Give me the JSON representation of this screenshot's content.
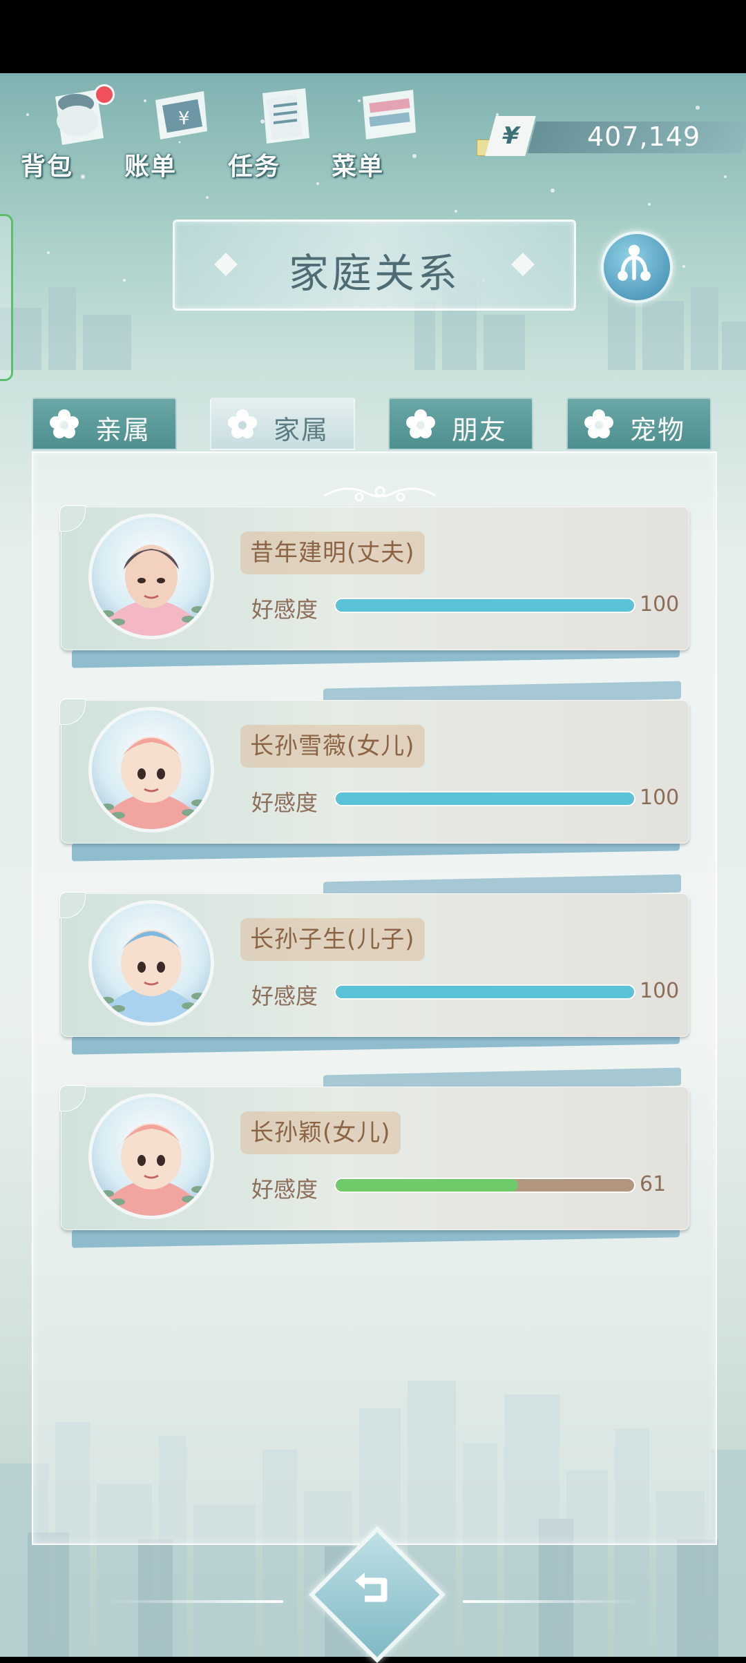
{
  "toolbar": {
    "bag_label": "背包",
    "bills_label": "账单",
    "tasks_label": "任务",
    "menu_label": "菜单"
  },
  "currency": {
    "symbol": "¥",
    "amount": "407,149"
  },
  "page": {
    "title": "家庭关系"
  },
  "tabs": [
    {
      "label": "亲属",
      "active": false
    },
    {
      "label": "家属",
      "active": true
    },
    {
      "label": "朋友",
      "active": false
    },
    {
      "label": "宠物",
      "active": false
    }
  ],
  "affinity_label": "好感度",
  "members": [
    {
      "name": "昔年建明(丈夫)",
      "affinity": 100,
      "max": 100,
      "bar_color": "#5bc3d8",
      "avatar_icon": "husband-avatar"
    },
    {
      "name": "长孙雪薇(女儿)",
      "affinity": 100,
      "max": 100,
      "bar_color": "#5bc3d8",
      "avatar_icon": "daughter-avatar"
    },
    {
      "name": "长孙子生(儿子)",
      "affinity": 100,
      "max": 100,
      "bar_color": "#5bc3d8",
      "avatar_icon": "son-avatar"
    },
    {
      "name": "长孙颖(女儿)",
      "affinity": 61,
      "max": 100,
      "bar_color": "#6fcb6a",
      "avatar_icon": "daughter-avatar"
    }
  ],
  "colors": {
    "tab_inactive": "#5a9a9a",
    "tab_active": "#dcebec",
    "name_chip": "#dcc3a6",
    "bar_track": "#b39680",
    "notification": "#f0505a"
  }
}
